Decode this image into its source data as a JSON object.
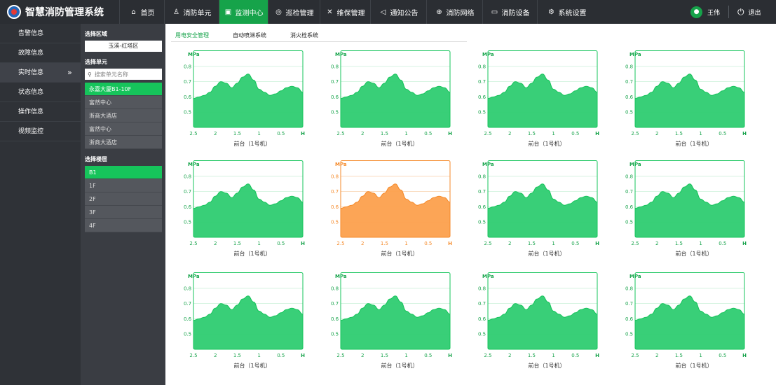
{
  "app": {
    "title": "智慧消防管理系统"
  },
  "nav": [
    {
      "label": "首页",
      "icon": "home-icon",
      "glyph": "⌂",
      "active": false
    },
    {
      "label": "消防单元",
      "icon": "extinguisher-icon",
      "glyph": "♙",
      "active": false
    },
    {
      "label": "监测中心",
      "icon": "monitor-icon",
      "glyph": "▣",
      "active": true
    },
    {
      "label": "巡检管理",
      "icon": "location-icon",
      "glyph": "◎",
      "active": false
    },
    {
      "label": "维保管理",
      "icon": "tools-icon",
      "glyph": "✕",
      "active": false
    },
    {
      "label": "通知公告",
      "icon": "speaker-icon",
      "glyph": "◁",
      "active": false
    },
    {
      "label": "消防网络",
      "icon": "globe-icon",
      "glyph": "⊕",
      "active": false
    },
    {
      "label": "消防设备",
      "icon": "device-icon",
      "glyph": "▭",
      "active": false
    },
    {
      "label": "系统设置",
      "icon": "gear-icon",
      "glyph": "⚙",
      "active": false
    }
  ],
  "user": {
    "name": "王伟",
    "logout_label": "退出"
  },
  "sidebar": {
    "items": [
      {
        "label": "告警信息",
        "active": false
      },
      {
        "label": "故障信息",
        "active": false
      },
      {
        "label": "实时信息",
        "active": true
      },
      {
        "label": "状态信息",
        "active": false
      },
      {
        "label": "操作信息",
        "active": false
      },
      {
        "label": "视频监控",
        "active": false
      }
    ]
  },
  "panel": {
    "region_label": "选择区域",
    "region_value": "玉溪-红塔区",
    "unit_label": "选择单元",
    "search_placeholder": "搜索单元名称",
    "units": [
      {
        "label": "永嘉大厦B1-10F",
        "active": true
      },
      {
        "label": "富然中心",
        "active": false
      },
      {
        "label": "浙商大酒店",
        "active": false
      },
      {
        "label": "富然中心",
        "active": false
      },
      {
        "label": "浙商大酒店",
        "active": false
      }
    ],
    "floor_label": "选择楼层",
    "floors": [
      {
        "label": "B1",
        "active": true
      },
      {
        "label": "1F",
        "active": false
      },
      {
        "label": "2F",
        "active": false
      },
      {
        "label": "3F",
        "active": false
      },
      {
        "label": "4F",
        "active": false
      }
    ]
  },
  "tabs": [
    {
      "label": "用电安全管理",
      "active": true
    },
    {
      "label": "自动喷淋系统",
      "active": false
    },
    {
      "label": "消火栓系统",
      "active": false
    }
  ],
  "colors": {
    "green": "#2ecc71",
    "green_line": "#16c45b",
    "orange": "#fca04d",
    "orange_line": "#f58a2a",
    "accent": "#16a34a"
  },
  "chart_common": {
    "type": "area",
    "unit_label": "MPa",
    "y_ticks": [
      "0.8",
      "0.7",
      "0.6",
      "0.5"
    ],
    "ylim": [
      0.4,
      0.85
    ],
    "x_ticks": [
      "2.5",
      "2",
      "1.5",
      "1",
      "0.5",
      "H"
    ],
    "xlabel": "前台（1号机）"
  },
  "chart_data": [
    {
      "type": "area",
      "alert": false,
      "x": [
        0,
        0.5,
        1,
        1.5,
        2,
        2.5,
        3,
        3.5,
        4,
        4.5,
        5,
        5.5,
        6,
        6.5,
        7,
        7.5,
        8,
        8.5,
        9,
        9.5,
        10
      ],
      "values": [
        0.59,
        0.6,
        0.61,
        0.63,
        0.67,
        0.7,
        0.69,
        0.66,
        0.69,
        0.73,
        0.75,
        0.71,
        0.65,
        0.63,
        0.61,
        0.62,
        0.64,
        0.66,
        0.67,
        0.66,
        0.63
      ]
    },
    {
      "type": "area",
      "alert": false,
      "x": [
        0,
        0.5,
        1,
        1.5,
        2,
        2.5,
        3,
        3.5,
        4,
        4.5,
        5,
        5.5,
        6,
        6.5,
        7,
        7.5,
        8,
        8.5,
        9,
        9.5,
        10
      ],
      "values": [
        0.59,
        0.6,
        0.61,
        0.63,
        0.67,
        0.7,
        0.69,
        0.66,
        0.69,
        0.73,
        0.75,
        0.71,
        0.65,
        0.63,
        0.61,
        0.62,
        0.64,
        0.66,
        0.67,
        0.66,
        0.63
      ]
    },
    {
      "type": "area",
      "alert": false,
      "x": [
        0,
        0.5,
        1,
        1.5,
        2,
        2.5,
        3,
        3.5,
        4,
        4.5,
        5,
        5.5,
        6,
        6.5,
        7,
        7.5,
        8,
        8.5,
        9,
        9.5,
        10
      ],
      "values": [
        0.59,
        0.6,
        0.61,
        0.63,
        0.67,
        0.7,
        0.69,
        0.66,
        0.69,
        0.73,
        0.75,
        0.71,
        0.65,
        0.63,
        0.61,
        0.62,
        0.64,
        0.66,
        0.67,
        0.66,
        0.63
      ]
    },
    {
      "type": "area",
      "alert": false,
      "x": [
        0,
        0.5,
        1,
        1.5,
        2,
        2.5,
        3,
        3.5,
        4,
        4.5,
        5,
        5.5,
        6,
        6.5,
        7,
        7.5,
        8,
        8.5,
        9,
        9.5,
        10
      ],
      "values": [
        0.59,
        0.6,
        0.61,
        0.63,
        0.67,
        0.7,
        0.69,
        0.66,
        0.69,
        0.73,
        0.75,
        0.71,
        0.65,
        0.63,
        0.61,
        0.62,
        0.64,
        0.66,
        0.67,
        0.66,
        0.63
      ]
    },
    {
      "type": "area",
      "alert": false,
      "x": [
        0,
        0.5,
        1,
        1.5,
        2,
        2.5,
        3,
        3.5,
        4,
        4.5,
        5,
        5.5,
        6,
        6.5,
        7,
        7.5,
        8,
        8.5,
        9,
        9.5,
        10
      ],
      "values": [
        0.59,
        0.6,
        0.61,
        0.63,
        0.67,
        0.7,
        0.69,
        0.66,
        0.69,
        0.73,
        0.75,
        0.71,
        0.65,
        0.63,
        0.61,
        0.62,
        0.64,
        0.66,
        0.67,
        0.66,
        0.63
      ]
    },
    {
      "type": "area",
      "alert": true,
      "x": [
        0,
        0.5,
        1,
        1.5,
        2,
        2.5,
        3,
        3.5,
        4,
        4.5,
        5,
        5.5,
        6,
        6.5,
        7,
        7.5,
        8,
        8.5,
        9,
        9.5,
        10
      ],
      "values": [
        0.59,
        0.6,
        0.61,
        0.63,
        0.67,
        0.7,
        0.69,
        0.66,
        0.69,
        0.73,
        0.75,
        0.71,
        0.65,
        0.63,
        0.61,
        0.62,
        0.64,
        0.66,
        0.67,
        0.66,
        0.63
      ]
    },
    {
      "type": "area",
      "alert": false,
      "x": [
        0,
        0.5,
        1,
        1.5,
        2,
        2.5,
        3,
        3.5,
        4,
        4.5,
        5,
        5.5,
        6,
        6.5,
        7,
        7.5,
        8,
        8.5,
        9,
        9.5,
        10
      ],
      "values": [
        0.59,
        0.6,
        0.61,
        0.63,
        0.67,
        0.7,
        0.69,
        0.66,
        0.69,
        0.73,
        0.75,
        0.71,
        0.65,
        0.63,
        0.61,
        0.62,
        0.64,
        0.66,
        0.67,
        0.66,
        0.63
      ]
    },
    {
      "type": "area",
      "alert": false,
      "x": [
        0,
        0.5,
        1,
        1.5,
        2,
        2.5,
        3,
        3.5,
        4,
        4.5,
        5,
        5.5,
        6,
        6.5,
        7,
        7.5,
        8,
        8.5,
        9,
        9.5,
        10
      ],
      "values": [
        0.59,
        0.6,
        0.61,
        0.63,
        0.67,
        0.7,
        0.69,
        0.66,
        0.69,
        0.73,
        0.75,
        0.71,
        0.65,
        0.63,
        0.61,
        0.62,
        0.64,
        0.66,
        0.67,
        0.66,
        0.63
      ]
    },
    {
      "type": "area",
      "alert": false,
      "x": [
        0,
        0.5,
        1,
        1.5,
        2,
        2.5,
        3,
        3.5,
        4,
        4.5,
        5,
        5.5,
        6,
        6.5,
        7,
        7.5,
        8,
        8.5,
        9,
        9.5,
        10
      ],
      "values": [
        0.59,
        0.6,
        0.61,
        0.63,
        0.67,
        0.7,
        0.69,
        0.66,
        0.69,
        0.73,
        0.75,
        0.71,
        0.65,
        0.63,
        0.61,
        0.62,
        0.64,
        0.66,
        0.67,
        0.66,
        0.63
      ]
    },
    {
      "type": "area",
      "alert": false,
      "x": [
        0,
        0.5,
        1,
        1.5,
        2,
        2.5,
        3,
        3.5,
        4,
        4.5,
        5,
        5.5,
        6,
        6.5,
        7,
        7.5,
        8,
        8.5,
        9,
        9.5,
        10
      ],
      "values": [
        0.59,
        0.6,
        0.61,
        0.63,
        0.67,
        0.7,
        0.69,
        0.66,
        0.69,
        0.73,
        0.75,
        0.71,
        0.65,
        0.63,
        0.61,
        0.62,
        0.64,
        0.66,
        0.67,
        0.66,
        0.63
      ]
    },
    {
      "type": "area",
      "alert": false,
      "x": [
        0,
        0.5,
        1,
        1.5,
        2,
        2.5,
        3,
        3.5,
        4,
        4.5,
        5,
        5.5,
        6,
        6.5,
        7,
        7.5,
        8,
        8.5,
        9,
        9.5,
        10
      ],
      "values": [
        0.59,
        0.6,
        0.61,
        0.63,
        0.67,
        0.7,
        0.69,
        0.66,
        0.69,
        0.73,
        0.75,
        0.71,
        0.65,
        0.63,
        0.61,
        0.62,
        0.64,
        0.66,
        0.67,
        0.66,
        0.63
      ]
    },
    {
      "type": "area",
      "alert": false,
      "x": [
        0,
        0.5,
        1,
        1.5,
        2,
        2.5,
        3,
        3.5,
        4,
        4.5,
        5,
        5.5,
        6,
        6.5,
        7,
        7.5,
        8,
        8.5,
        9,
        9.5,
        10
      ],
      "values": [
        0.59,
        0.6,
        0.61,
        0.63,
        0.67,
        0.7,
        0.69,
        0.66,
        0.69,
        0.73,
        0.75,
        0.71,
        0.65,
        0.63,
        0.61,
        0.62,
        0.64,
        0.66,
        0.67,
        0.66,
        0.63
      ]
    }
  ]
}
